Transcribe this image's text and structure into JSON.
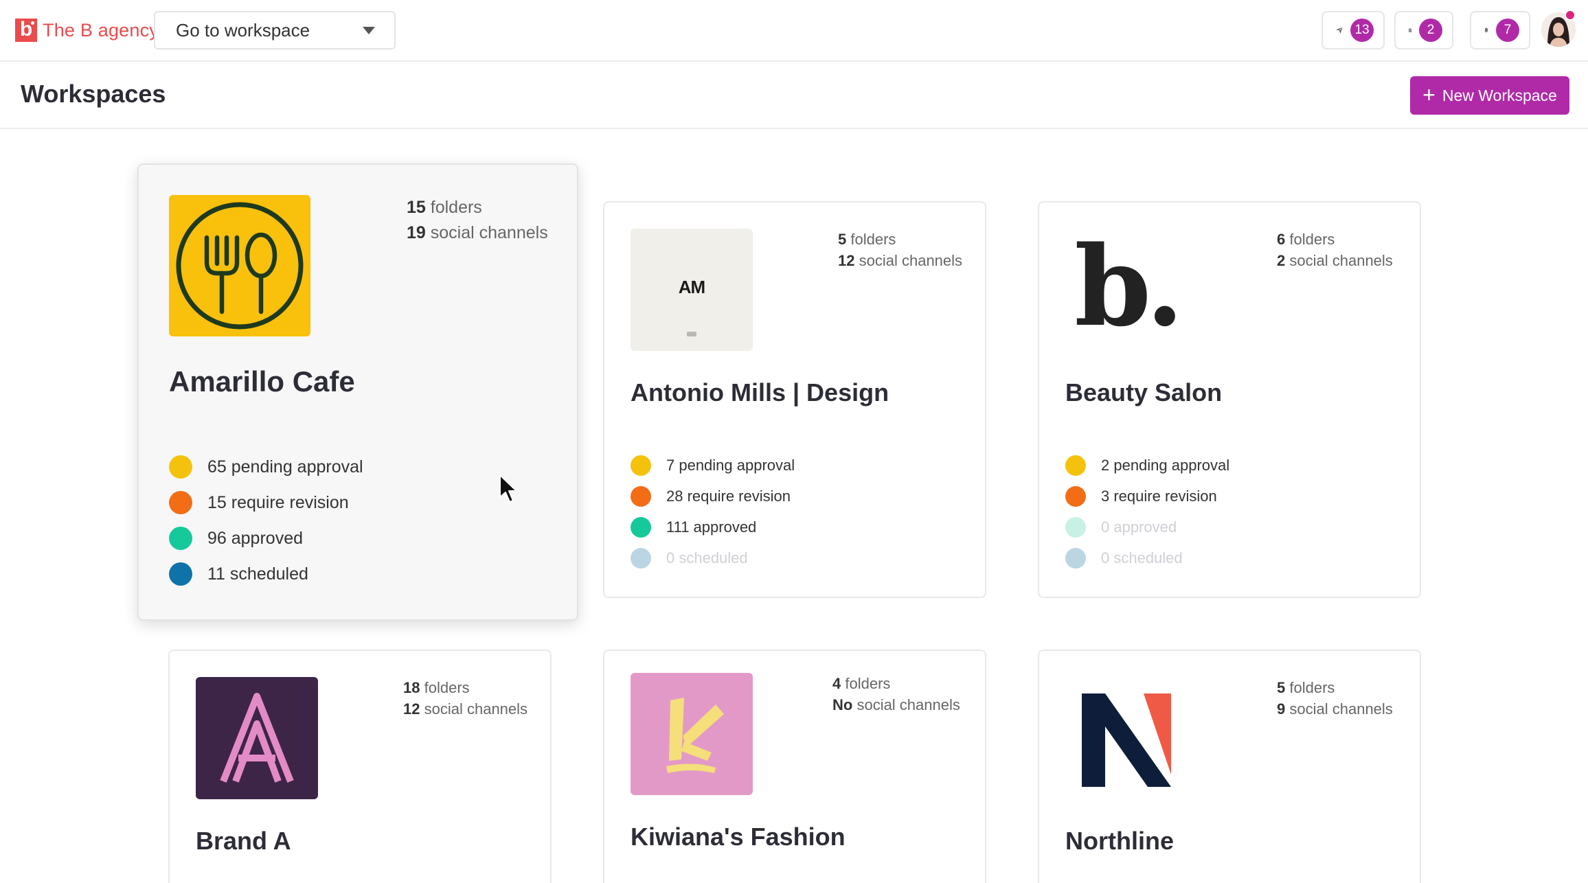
{
  "brand": {
    "mark": "b",
    "name": "The B agency"
  },
  "workspace_select": {
    "label": "Go to workspace"
  },
  "topbar": {
    "send_badge": "13",
    "clipboard_badge": "2",
    "notifications_badge": "7"
  },
  "page": {
    "title": "Workspaces",
    "new_button_label": "New Workspace"
  },
  "colors": {
    "accent": "#b02aa8",
    "pending": "#f4c20d",
    "revision": "#f26d16",
    "approved": "#16c99a",
    "scheduled": "#0f72a8"
  },
  "workspaces": [
    {
      "name": "Amarillo Cafe",
      "folders_count": "15",
      "folders_label": "folders",
      "channels_count": "19",
      "channels_label": "social channels",
      "pending": "65 pending approval",
      "revision": "15 require revision",
      "approved": "96 approved",
      "scheduled": "11 scheduled"
    },
    {
      "name": "Antonio Mills | Design",
      "logo_text": "AM",
      "folders_count": "5",
      "folders_label": "folders",
      "channels_count": "12",
      "channels_label": "social channels",
      "pending": "7 pending approval",
      "revision": "28 require revision",
      "approved": "111 approved",
      "scheduled": "0 scheduled"
    },
    {
      "name": "Beauty Salon",
      "logo_text": "b.",
      "folders_count": "6",
      "folders_label": "folders",
      "channels_count": "2",
      "channels_label": "social channels",
      "pending": "2 pending approval",
      "revision": "3 require revision",
      "approved": "0 approved",
      "scheduled": "0 scheduled"
    },
    {
      "name": "Brand A",
      "logo_text": "A",
      "folders_count": "18",
      "folders_label": "folders",
      "channels_count": "12",
      "channels_label": "social channels"
    },
    {
      "name": "Kiwiana's Fashion",
      "folders_count": "4",
      "folders_label": "folders",
      "channels_count": "No",
      "channels_label": "social channels"
    },
    {
      "name": "Northline",
      "folders_count": "5",
      "folders_label": "folders",
      "channels_count": "9",
      "channels_label": "social channels"
    }
  ]
}
